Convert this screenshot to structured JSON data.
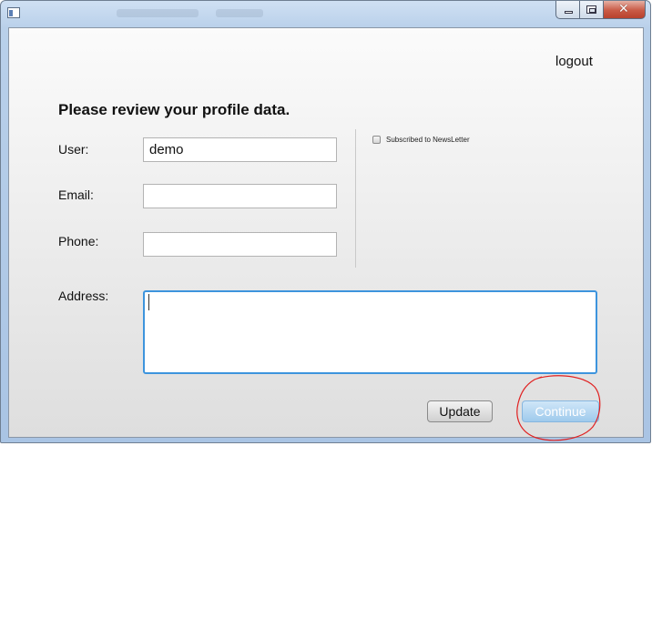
{
  "window": {
    "controls": {
      "minimize": "minimize-icon",
      "maximize": "maximize-icon",
      "close": "close-icon"
    }
  },
  "header": {
    "logout_label": "logout"
  },
  "form": {
    "heading": "Please review your profile data.",
    "user": {
      "label": "User:",
      "value": "demo",
      "placeholder": ""
    },
    "email": {
      "label": "Email:",
      "value": "",
      "placeholder": ""
    },
    "phone": {
      "label": "Phone:",
      "value": "",
      "placeholder": ""
    },
    "address": {
      "label": "Address:",
      "value": ""
    },
    "newsletter": {
      "label": "Subscribed to NewsLetter",
      "checked": false
    }
  },
  "actions": {
    "update_label": "Update",
    "continue_label": "Continue"
  },
  "colors": {
    "focus_border": "#3d94dd",
    "continue_bg": "#9fcaec",
    "annotation": "#e02020"
  }
}
